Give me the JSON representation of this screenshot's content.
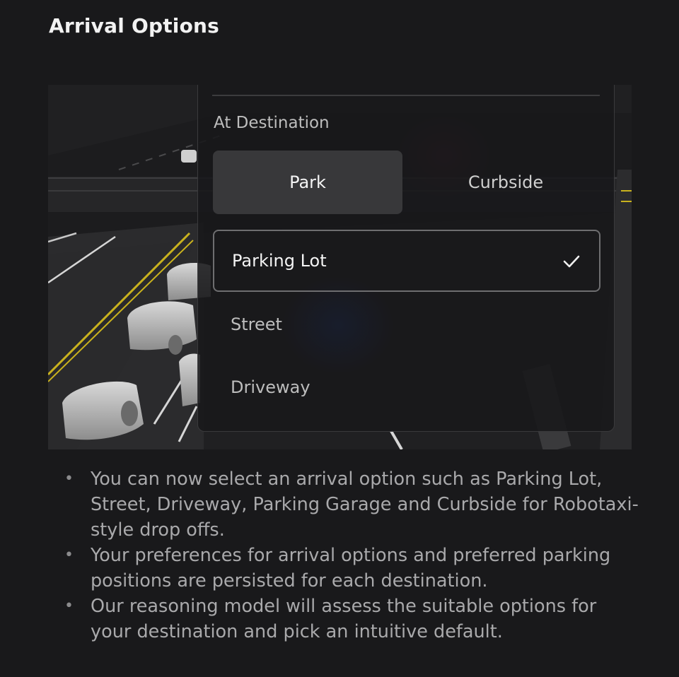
{
  "header": {
    "title": "Arrival Options"
  },
  "arrival_panel": {
    "section_label": "At Destination",
    "segments": [
      {
        "label": "Park",
        "active": true
      },
      {
        "label": "Curbside",
        "active": false
      }
    ],
    "options": [
      {
        "label": "Parking Lot",
        "selected": true,
        "icon": "checkmark-icon"
      },
      {
        "label": "Street",
        "selected": false
      },
      {
        "label": "Driveway",
        "selected": false
      }
    ]
  },
  "notes": [
    "You can now select an arrival option such as Parking Lot, Street, Driveway, Parking Garage and Curbside for Robotaxi-style drop offs.",
    "Your preferences for arrival options and preferred parking positions are persisted for each destination.",
    "Our reasoning model will assess the suitable options for your destination and pick an intuitive default."
  ],
  "colors": {
    "background": "#19191b",
    "lane_yellow": "#c9b21e",
    "accent_blue": "#1f4fd6"
  }
}
